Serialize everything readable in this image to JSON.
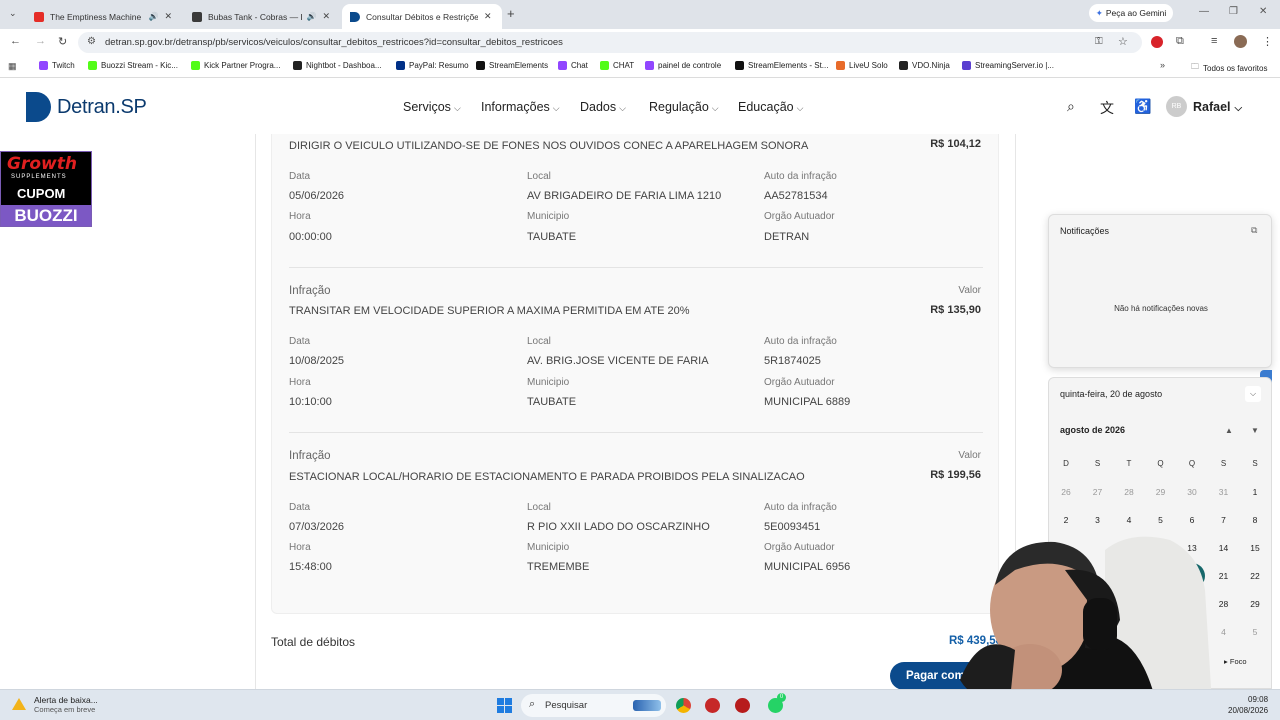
{
  "browser": {
    "tabs": [
      {
        "title": "The Emptiness Machine (Of",
        "favicon_color": "#e52d27"
      },
      {
        "title": "Bubas Tank - Cobras — Bai",
        "favicon_color": "#3a3a3a"
      },
      {
        "title": "Consultar Débitos e Restriçõe",
        "favicon_color": "#0b4a8c"
      }
    ],
    "new_tab": "+",
    "gemini_label": "Peça ao Gemini",
    "url": "detran.sp.gov.br/detransp/pb/servicos/veiculos/consultar_debitos_restricoes?id=consultar_debitos_restricoes",
    "bookmarks": [
      {
        "label": "Twitch",
        "color": "#9146ff"
      },
      {
        "label": "Buozzi Stream - Kic...",
        "color": "#53fc18"
      },
      {
        "label": "Kick Partner Progra...",
        "color": "#53fc18"
      },
      {
        "label": "Nightbot - Dashboa...",
        "color": "#222222"
      },
      {
        "label": "PayPal: Resumo",
        "color": "#003087"
      },
      {
        "label": "StreamElements",
        "color": "#111111"
      },
      {
        "label": "Chat",
        "color": "#9146ff"
      },
      {
        "label": "CHAT",
        "color": "#53fc18"
      },
      {
        "label": "painel de controle",
        "color": "#9146ff"
      },
      {
        "label": "StreamElements - St...",
        "color": "#111111"
      },
      {
        "label": "LiveU Solo",
        "color": "#e86b2a"
      },
      {
        "label": "VDO.Ninja",
        "color": "#222222"
      },
      {
        "label": "StreamingServer.io |...",
        "color": "#5a3fd0"
      }
    ],
    "all_bookmarks": "Todos os favoritos"
  },
  "site": {
    "logo_text": "Detran.SP",
    "menu": [
      "Serviços",
      "Informações",
      "Dados",
      "Regulação",
      "Educação"
    ],
    "avatar_initials": "RB",
    "username": "Rafael"
  },
  "ad": {
    "line1": "Growth",
    "line2": "SUPPLEMENTS",
    "line3": "CUPOM",
    "line4": "BUOZZI"
  },
  "labels": {
    "infracao": "Infração",
    "valor": "Valor",
    "data": "Data",
    "local": "Local",
    "auto": "Auto da infração",
    "hora": "Hora",
    "municipio": "Municipio",
    "orgao": "Orgão Autuador"
  },
  "infractions": [
    {
      "title": "DIRIGIR O VEICULO UTILIZANDO-SE DE FONES NOS OUVIDOS CONEC A APARELHAGEM SONORA",
      "value": "R$ 104,12",
      "date": "05/06/2026",
      "local": "AV BRIGADEIRO DE FARIA LIMA 1210",
      "auto": "AA52781534",
      "hour": "00:00:00",
      "municipio": "TAUBATE",
      "orgao": "DETRAN"
    },
    {
      "title": "TRANSITAR EM VELOCIDADE SUPERIOR A MAXIMA PERMITIDA EM ATE 20%",
      "value": "R$ 135,90",
      "date": "10/08/2025",
      "local": "AV. BRIG.JOSE VICENTE DE FARIA",
      "auto": "5R1874025",
      "hour": "10:10:00",
      "municipio": "TAUBATE",
      "orgao": "MUNICIPAL 6889"
    },
    {
      "title": "ESTACIONAR LOCAL/HORARIO DE ESTACIONAMENTO E PARADA PROIBIDOS PELA SINALIZACAO",
      "value": "R$ 199,56",
      "date": "07/03/2026",
      "local": "R PIO XXII LADO DO OSCARZINHO",
      "auto": "5E0093451",
      "hour": "15:48:00",
      "municipio": "TREMEMBE",
      "orgao": "MUNICIPAL 6956"
    }
  ],
  "total": {
    "label": "Total de débitos",
    "value": "R$ 439,58"
  },
  "pay_button": "Pagar com",
  "notifications": {
    "title": "Notificações",
    "empty": "Não há notificações novas"
  },
  "calendar": {
    "date_header": "quinta-feira, 20 de agosto",
    "month": "agosto de 2026",
    "weekdays": [
      "D",
      "S",
      "T",
      "Q",
      "Q",
      "S",
      "S"
    ],
    "visible_days": [
      [
        "26",
        "27",
        "28",
        "29",
        "30",
        "31",
        "1"
      ],
      [
        "2",
        "3",
        "4",
        "5",
        "6",
        "7",
        "8"
      ],
      [
        "",
        "",
        "",
        "12",
        "13",
        "14",
        "15"
      ],
      [
        "",
        "",
        "",
        "",
        "20",
        "21",
        "22"
      ],
      [
        "",
        "",
        "",
        "",
        "27",
        "28",
        "29"
      ],
      [
        "",
        "",
        "",
        "",
        "",
        "4",
        "5"
      ]
    ],
    "today": "20",
    "focus_label": "Foco"
  },
  "taskbar": {
    "alert_title": "Alerta de baixa...",
    "alert_sub": "Começa em breve",
    "search": "Pesquisar",
    "time": "09:08",
    "date": "20/08/2026",
    "whatsapp_badge": "0"
  }
}
